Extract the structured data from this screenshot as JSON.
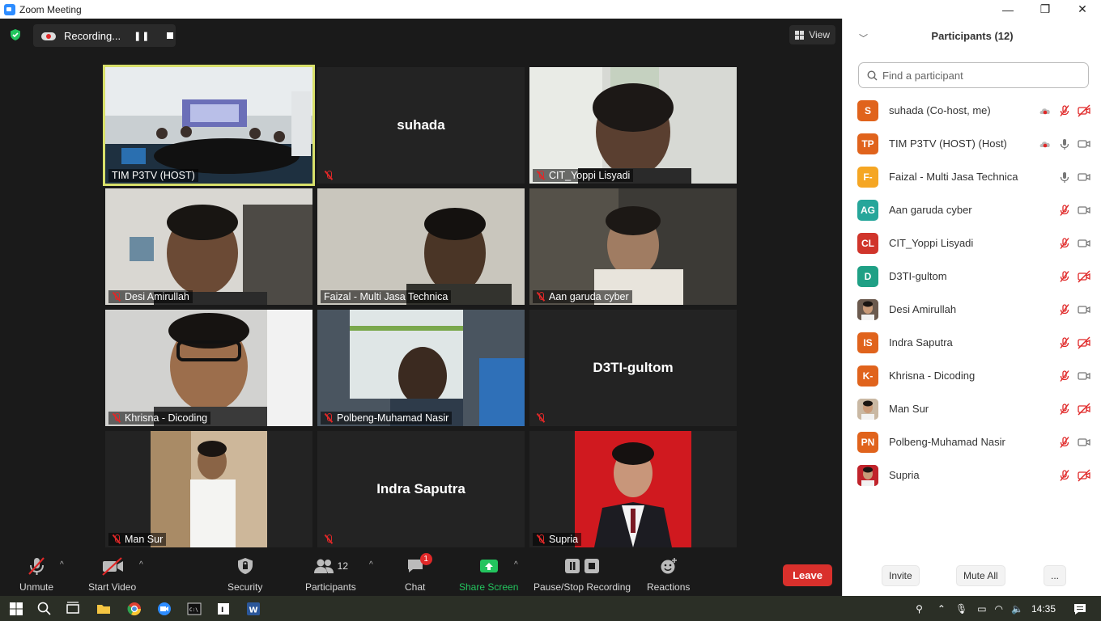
{
  "window": {
    "title": "Zoom Meeting",
    "controls": [
      "—",
      "❐",
      "✕"
    ]
  },
  "meeting": {
    "recording_label": "Recording...",
    "view_label": "View"
  },
  "tiles": [
    {
      "name": "TIM P3TV (HOST)",
      "display_name": "",
      "video": true,
      "muted": false
    },
    {
      "name": "",
      "display_name": "suhada",
      "video": false,
      "muted": true
    },
    {
      "name": "CIT_Yoppi Lisyadi",
      "display_name": "",
      "video": true,
      "muted": true
    },
    {
      "name": "Desi Amirullah",
      "display_name": "",
      "video": true,
      "muted": true
    },
    {
      "name": "Faizal - Multi Jasa Technica",
      "display_name": "",
      "video": true,
      "muted": false
    },
    {
      "name": "Aan garuda cyber",
      "display_name": "",
      "video": true,
      "muted": true
    },
    {
      "name": "Khrisna - Dicoding",
      "display_name": "",
      "video": true,
      "muted": true
    },
    {
      "name": "Polbeng-Muhamad Nasir",
      "display_name": "",
      "video": true,
      "muted": true
    },
    {
      "name": "",
      "display_name": "D3TI-gultom",
      "video": false,
      "muted": true
    },
    {
      "name": "Man Sur",
      "display_name": "",
      "video": true,
      "muted": true
    },
    {
      "name": "",
      "display_name": "Indra Saputra",
      "video": false,
      "muted": true
    },
    {
      "name": "Supria",
      "display_name": "",
      "video": true,
      "muted": true
    }
  ],
  "toolbar": {
    "unmute": "Unmute",
    "start_video": "Start Video",
    "security": "Security",
    "participants": "Participants",
    "participants_count": "12",
    "chat": "Chat",
    "chat_badge": "1",
    "share_screen": "Share Screen",
    "pause_stop": "Pause/Stop Recording",
    "reactions": "Reactions",
    "leave": "Leave"
  },
  "panel": {
    "title": "Participants (12)",
    "search_placeholder": "Find a participant",
    "participants": [
      {
        "initials": "S",
        "name": "suhada (Co-host, me)",
        "color": "#e0631c",
        "rec": true,
        "mic": "muted",
        "video": "off"
      },
      {
        "initials": "TP",
        "name": "TIM P3TV (HOST) (Host)",
        "color": "#e0631c",
        "rec": true,
        "mic": "on",
        "video": "on"
      },
      {
        "initials": "F-",
        "name": "Faizal - Multi Jasa Technica",
        "color": "#f5a623",
        "rec": false,
        "mic": "on",
        "video": "on"
      },
      {
        "initials": "AG",
        "name": "Aan garuda cyber",
        "color": "#26a69a",
        "rec": false,
        "mic": "muted",
        "video": "on"
      },
      {
        "initials": "CL",
        "name": "CIT_Yoppi Lisyadi",
        "color": "#d0352b",
        "rec": false,
        "mic": "muted",
        "video": "on"
      },
      {
        "initials": "D",
        "name": "D3TI-gultom",
        "color": "#1fa085",
        "rec": false,
        "mic": "muted",
        "video": "off"
      },
      {
        "initials": "",
        "name": "Desi Amirullah",
        "color": "#6b5a4e",
        "rec": false,
        "mic": "muted",
        "video": "on"
      },
      {
        "initials": "IS",
        "name": "Indra Saputra",
        "color": "#e0631c",
        "rec": false,
        "mic": "muted",
        "video": "off"
      },
      {
        "initials": "K-",
        "name": "Khrisna - Dicoding",
        "color": "#e0631c",
        "rec": false,
        "mic": "muted",
        "video": "on"
      },
      {
        "initials": "",
        "name": "Man Sur",
        "color": "#c9b8a3",
        "rec": false,
        "mic": "muted",
        "video": "off"
      },
      {
        "initials": "PN",
        "name": "Polbeng-Muhamad Nasir",
        "color": "#e0631c",
        "rec": false,
        "mic": "muted",
        "video": "on"
      },
      {
        "initials": "",
        "name": "Supria",
        "color": "#c0232b",
        "rec": false,
        "mic": "muted",
        "video": "off"
      }
    ],
    "invite": "Invite",
    "mute_all": "Mute All",
    "more": "..."
  },
  "taskbar": {
    "time": "14:35"
  }
}
